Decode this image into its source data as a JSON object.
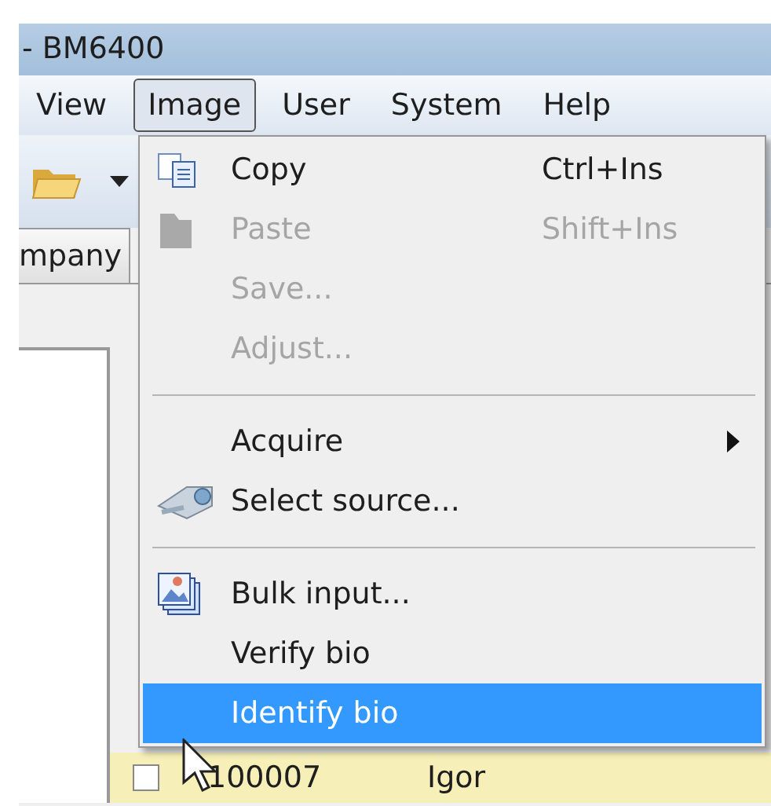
{
  "window": {
    "title": "- BM6400"
  },
  "menubar": [
    {
      "label": "View",
      "selected": false
    },
    {
      "label": "Image",
      "selected": true
    },
    {
      "label": "User",
      "selected": false
    },
    {
      "label": "System",
      "selected": false
    },
    {
      "label": "Help",
      "selected": false
    }
  ],
  "tab": {
    "label": "mpany"
  },
  "menu": [
    {
      "kind": "item",
      "label": "Copy",
      "shortcut": "Ctrl+Ins",
      "disabled": false,
      "submenu": false,
      "selected": false
    },
    {
      "kind": "item",
      "label": "Paste",
      "shortcut": "Shift+Ins",
      "disabled": true,
      "submenu": false,
      "selected": false
    },
    {
      "kind": "item",
      "label": "Save...",
      "disabled": true,
      "submenu": false,
      "selected": false
    },
    {
      "kind": "item",
      "label": "Adjust...",
      "disabled": true,
      "submenu": false,
      "selected": false
    },
    {
      "kind": "separator"
    },
    {
      "kind": "item",
      "label": "Acquire",
      "disabled": false,
      "submenu": true,
      "selected": false
    },
    {
      "kind": "item",
      "label": "Select source...",
      "disabled": false,
      "submenu": false,
      "selected": false
    },
    {
      "kind": "separator"
    },
    {
      "kind": "item",
      "label": "Bulk input...",
      "disabled": false,
      "submenu": false,
      "selected": false
    },
    {
      "kind": "item",
      "label": "Verify bio",
      "disabled": false,
      "submenu": false,
      "selected": false
    },
    {
      "kind": "item",
      "label": "Identify bio",
      "disabled": false,
      "submenu": false,
      "selected": true
    }
  ],
  "table": {
    "rows": [
      {
        "checked": false,
        "cells": [
          "100007",
          "Igor"
        ]
      }
    ]
  }
}
